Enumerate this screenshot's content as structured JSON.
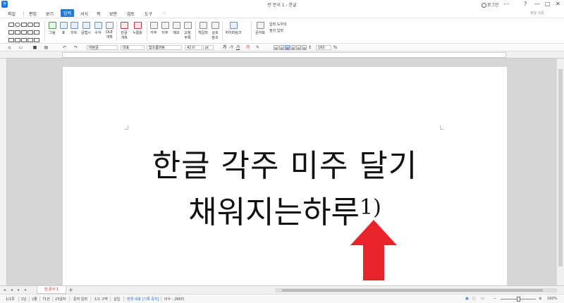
{
  "window": {
    "title": "빈 문서 1 - 한글",
    "login_label": "로그인",
    "controls": [
      "⋯",
      "?",
      "—",
      "□",
      "✕"
    ]
  },
  "menu": {
    "file": "파일",
    "items": [
      "편집",
      "보기",
      "입력",
      "서식",
      "쪽",
      "보안",
      "검토",
      "도구"
    ],
    "active_index": 2,
    "search_hint": "찾을 내용"
  },
  "ribbon": {
    "buttons": [
      {
        "label": "그림",
        "icon": "picture-icon"
      },
      {
        "label": "표",
        "icon": "table-icon"
      },
      {
        "label": "차트",
        "icon": "chart-icon"
      },
      {
        "label": "글맵시",
        "icon": "wordart-icon"
      },
      {
        "label": "수식",
        "icon": "formula-icon"
      },
      {
        "label": "개체",
        "icon": "object-icon",
        "label_top": "OLE"
      },
      {
        "label": "개체",
        "icon": "hangul-object-icon",
        "label_top": "한글"
      },
      {
        "label": "누름틀",
        "icon": "field-icon"
      },
      {
        "label": "각주",
        "icon": "footnote-icon"
      },
      {
        "label": "미주",
        "icon": "endnote-icon"
      },
      {
        "label": "메모",
        "icon": "memo-icon"
      },
      {
        "label": "부록",
        "icon": "appendix-icon",
        "label_top": "교정"
      },
      {
        "label": "책갈피",
        "icon": "bookmark-icon"
      },
      {
        "label": "참조",
        "icon": "crossref-icon",
        "label_top": "상호"
      },
      {
        "label": "하이퍼링크",
        "icon": "hyperlink-icon"
      },
      {
        "label": "문자표",
        "icon": "symbol-icon"
      }
    ],
    "side_items": [
      "입력 도우미",
      "정치 입력"
    ]
  },
  "format": {
    "style": "바탕글",
    "lang": "대표",
    "font": "함초롬바탕",
    "size": "42.0",
    "unit": "pt",
    "zoom": "160",
    "percent": "%"
  },
  "document": {
    "line1": "한글 각주 미주 달기",
    "line2": "채워지는하루",
    "footnote_mark": "1)"
  },
  "tabs": {
    "doc_tab": "빈 문서 1",
    "add": "+"
  },
  "status": {
    "items": [
      "1/1쪽",
      "1단",
      "2줄",
      "71칸",
      "23글자",
      "문자 입력",
      "1/1 구역",
      "삽입"
    ],
    "track_changes": "변경 내용 [기록 중지]",
    "count": "타수 : 266타",
    "zoom": "160%"
  },
  "colors": {
    "accent": "#1f7ad6",
    "arrow": "#e8232b"
  }
}
